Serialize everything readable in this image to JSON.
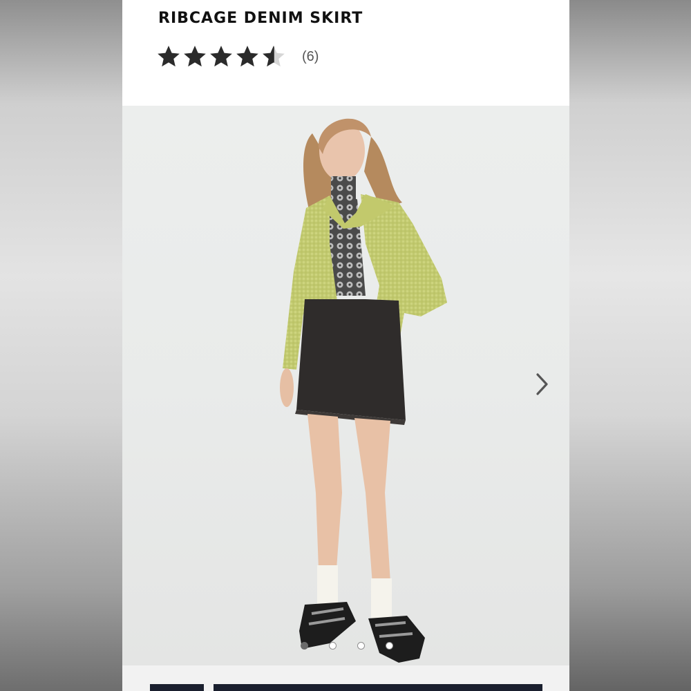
{
  "product": {
    "title": "RIBCAGE DENIM SKIRT",
    "rating": 4.5,
    "rating_max": 5,
    "review_count": "(6)"
  },
  "gallery": {
    "image_count": 4,
    "active_index": 0,
    "next_icon": "chevron-right-icon"
  },
  "colors": {
    "star": "#2b2b2b",
    "star_empty": "#d6d6d6",
    "jacket": "#c9d07a",
    "skirt": "#2f2c2b",
    "action_bar": "#1a1f2e"
  }
}
